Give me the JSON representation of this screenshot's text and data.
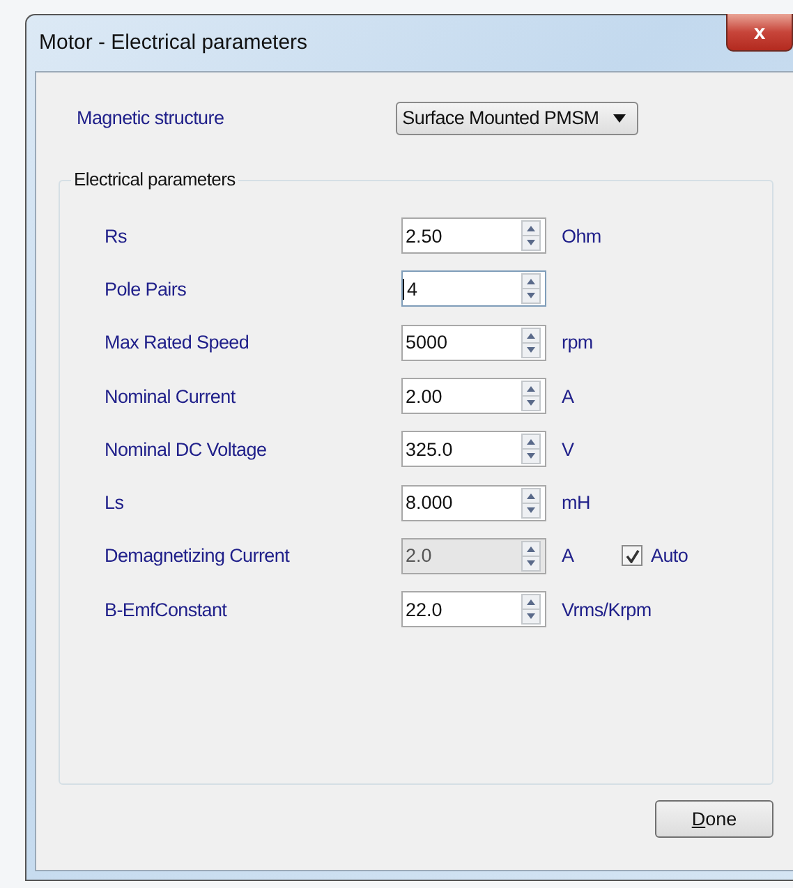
{
  "window": {
    "title": "Motor - Electrical parameters",
    "close": "x"
  },
  "magnetic_structure": {
    "label": "Magnetic structure",
    "value": "Surface Mounted PMSM"
  },
  "group": {
    "title": "Electrical parameters"
  },
  "rows": [
    {
      "label": "Rs",
      "value": "2.50",
      "unit": "Ohm",
      "disabled": false,
      "focused": false
    },
    {
      "label": "Pole Pairs",
      "value": "4",
      "disabled": false,
      "focused": true
    },
    {
      "label": "Max Rated Speed",
      "value": "5000",
      "unit": "rpm",
      "disabled": false,
      "focused": false
    },
    {
      "label": "Nominal Current",
      "value": "2.00",
      "unit": "A",
      "disabled": false,
      "focused": false
    },
    {
      "label": "Nominal DC Voltage",
      "value": "325.0",
      "unit": "V",
      "disabled": false,
      "focused": false
    },
    {
      "label": "Ls",
      "value": "8.000",
      "unit": "mH",
      "disabled": false,
      "focused": false
    },
    {
      "label": "Demagnetizing Current",
      "value": "2.0",
      "unit": "A",
      "disabled": true,
      "focused": false,
      "auto": {
        "label": "Auto",
        "checked": true
      }
    },
    {
      "label": "B-EmfConstant",
      "value": "22.0",
      "unit": "Vrms/Krpm",
      "disabled": false,
      "focused": false
    }
  ],
  "buttons": [
    {
      "label": "Done"
    }
  ]
}
